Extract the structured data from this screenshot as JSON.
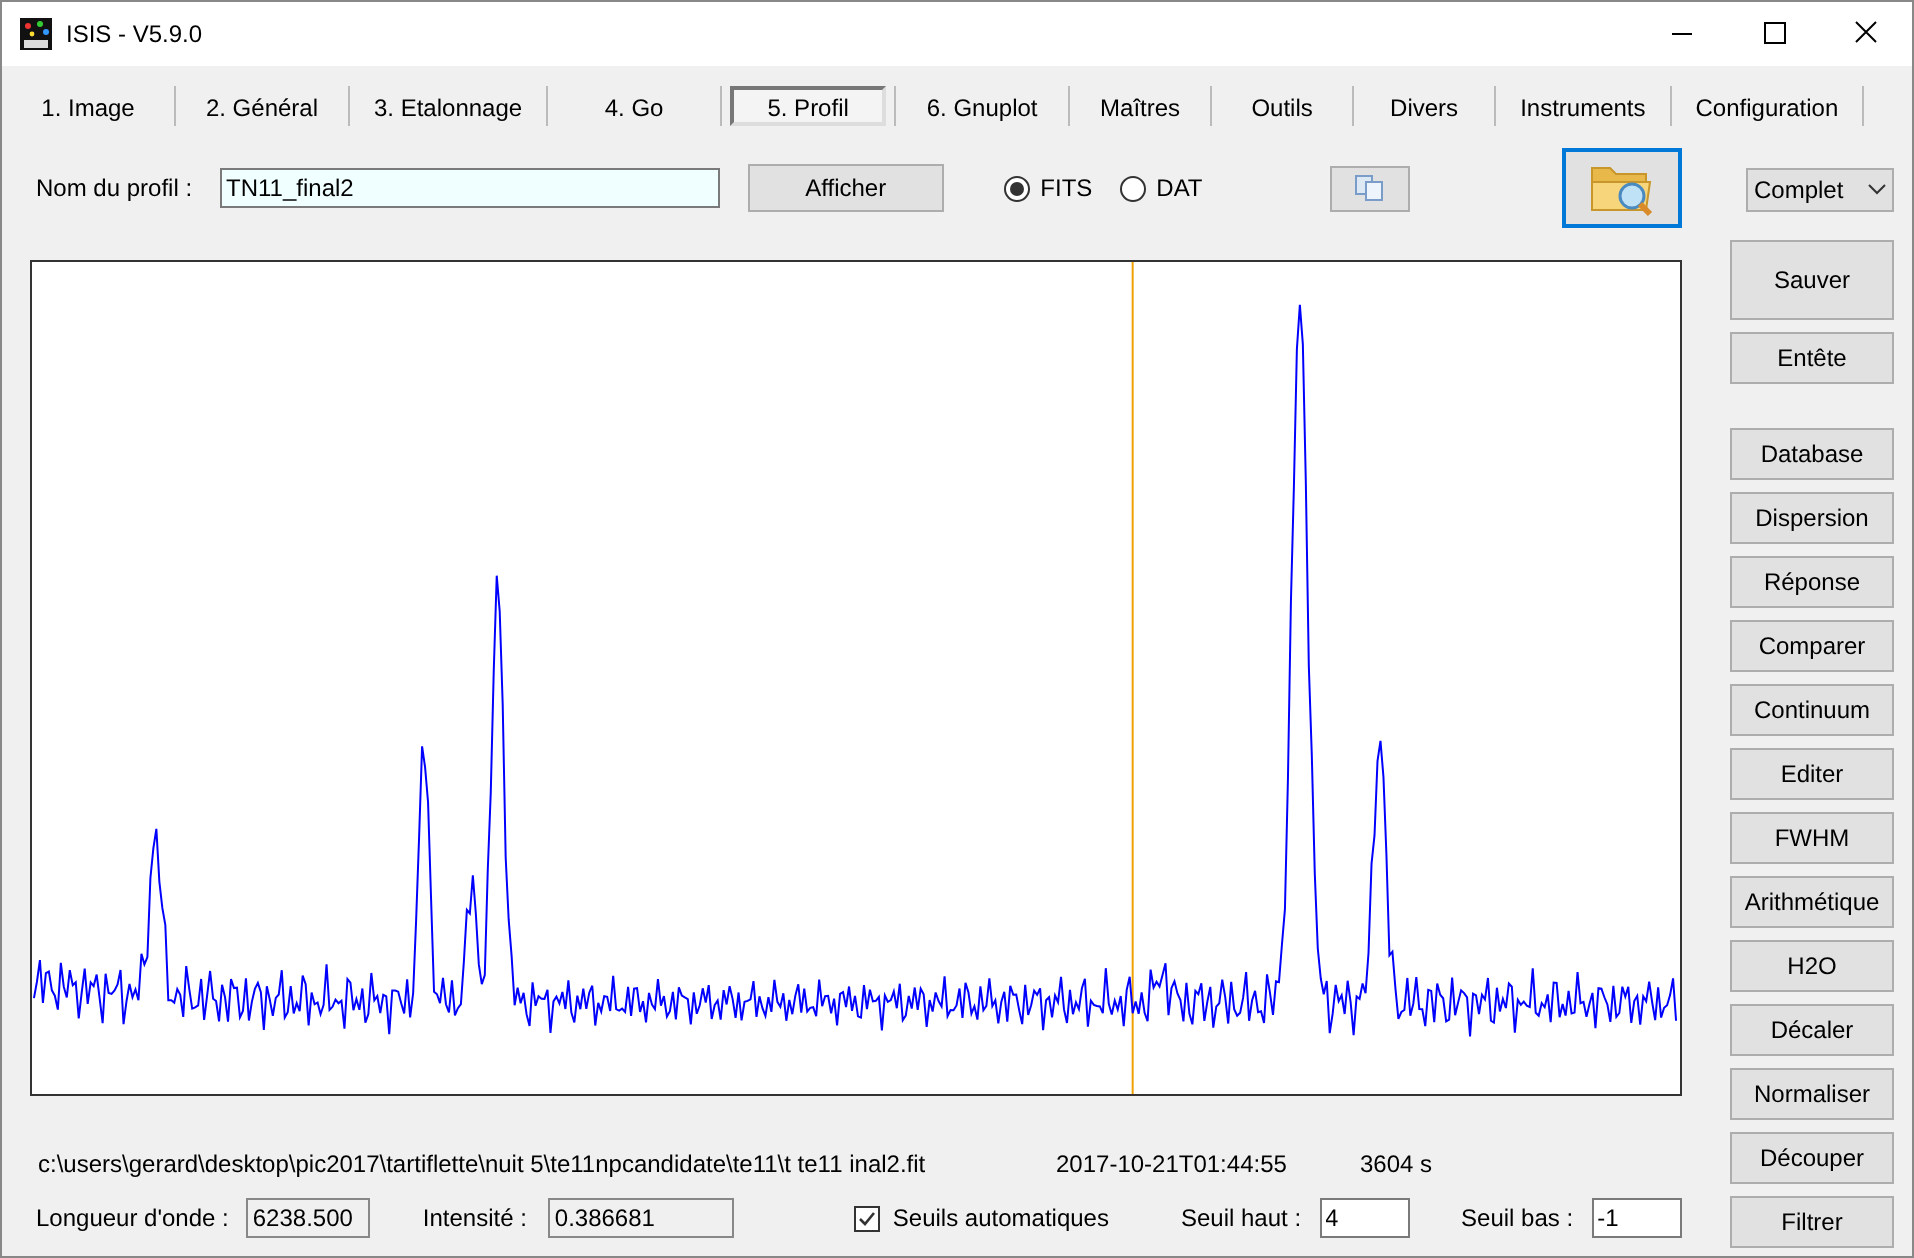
{
  "window": {
    "title": "ISIS - V5.9.0"
  },
  "tabs": [
    {
      "label": "1. Image",
      "selected": false
    },
    {
      "label": "2. Général",
      "selected": false
    },
    {
      "label": "3. Etalonnage",
      "selected": false
    },
    {
      "label": "4. Go",
      "selected": false
    },
    {
      "label": "5. Profil",
      "selected": true
    },
    {
      "label": "6. Gnuplot",
      "selected": false
    },
    {
      "label": "Maîtres",
      "selected": false
    },
    {
      "label": "Outils",
      "selected": false
    },
    {
      "label": "Divers",
      "selected": false
    },
    {
      "label": "Instruments",
      "selected": false
    },
    {
      "label": "Configuration",
      "selected": false
    }
  ],
  "profile": {
    "label": "Nom du profil :",
    "value": "TN11_final2",
    "button": "Afficher"
  },
  "formats": [
    {
      "label": "FITS",
      "selected": true
    },
    {
      "label": "DAT",
      "selected": false
    }
  ],
  "mode_select": {
    "value": "Complet"
  },
  "side_buttons": [
    {
      "label": "Sauver",
      "kind": "large"
    },
    {
      "label": "Entête",
      "kind": "normal"
    },
    {
      "label": "Database",
      "kind": "spaced"
    },
    {
      "label": "Dispersion",
      "kind": "normal"
    },
    {
      "label": "Réponse",
      "kind": "normal"
    },
    {
      "label": "Comparer",
      "kind": "normal"
    },
    {
      "label": "Continuum",
      "kind": "normal"
    },
    {
      "label": "Editer",
      "kind": "normal"
    },
    {
      "label": "FWHM",
      "kind": "normal"
    },
    {
      "label": "Arithmétique",
      "kind": "normal"
    },
    {
      "label": "H2O",
      "kind": "normal"
    },
    {
      "label": "Décaler",
      "kind": "normal"
    },
    {
      "label": "Normaliser",
      "kind": "normal"
    },
    {
      "label": "Découper",
      "kind": "normal"
    },
    {
      "label": "Filtrer",
      "kind": "normal"
    }
  ],
  "status": {
    "path": "c:\\users\\gerard\\desktop\\pic2017\\tartiflette\\nuit 5\\te11npcandidate\\te11\\t te11 inal2.fit",
    "datetime": "2017-10-21T01:44:55",
    "exposure": "3604 s"
  },
  "readouts": {
    "wavelength_label": "Longueur d'onde :",
    "wavelength": "6238.500",
    "intensity_label": "Intensité :",
    "intensity": "0.386681"
  },
  "auto_thresholds": {
    "label": "Seuils automatiques",
    "checked": true
  },
  "threshold_high": {
    "label": "Seuil haut :",
    "value": "4"
  },
  "threshold_low": {
    "label": "Seuil bas :",
    "value": "-1"
  }
}
